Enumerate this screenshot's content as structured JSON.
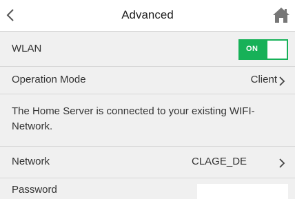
{
  "header": {
    "title": "Advanced",
    "back_icon": "chevron-left-icon",
    "home_icon": "home-icon"
  },
  "wlan": {
    "label": "WLAN",
    "toggle_label": "ON",
    "enabled": true,
    "toggle_color": "#17b158"
  },
  "operation_mode": {
    "label": "Operation Mode",
    "value": "Client"
  },
  "info": {
    "text": "The Home Server is connected to your existing WIFI-Network."
  },
  "network": {
    "label": "Network",
    "value": "CLAGE_DE"
  },
  "password": {
    "label": "Password",
    "value": ""
  },
  "colors": {
    "row_background": "#f0f0f0",
    "divider": "#d6d6d6",
    "accent": "#17b158"
  }
}
